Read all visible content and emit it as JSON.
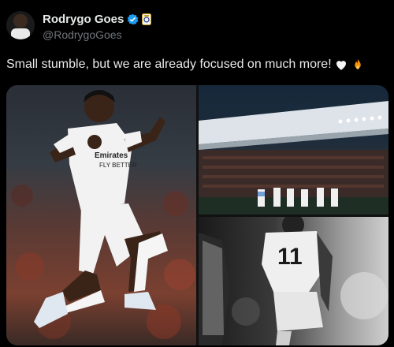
{
  "author": {
    "name": "Rodrygo Goes",
    "handle": "@RodrygoGoes"
  },
  "tweet": {
    "text": "Small stumble, but we are already focused on much more!",
    "emojis": [
      "white-heart",
      "fire"
    ]
  },
  "media": {
    "images": [
      {
        "name": "player-jumping-celebration",
        "jersey_text": "Emirates FLY BETTER"
      },
      {
        "name": "stadium-team-lineup"
      },
      {
        "name": "player-back-number-11",
        "jersey_number": "11"
      }
    ]
  },
  "colors": {
    "background": "#000000",
    "text": "#e7e9ea",
    "muted": "#71767b",
    "verified": "#1d9bf0"
  }
}
